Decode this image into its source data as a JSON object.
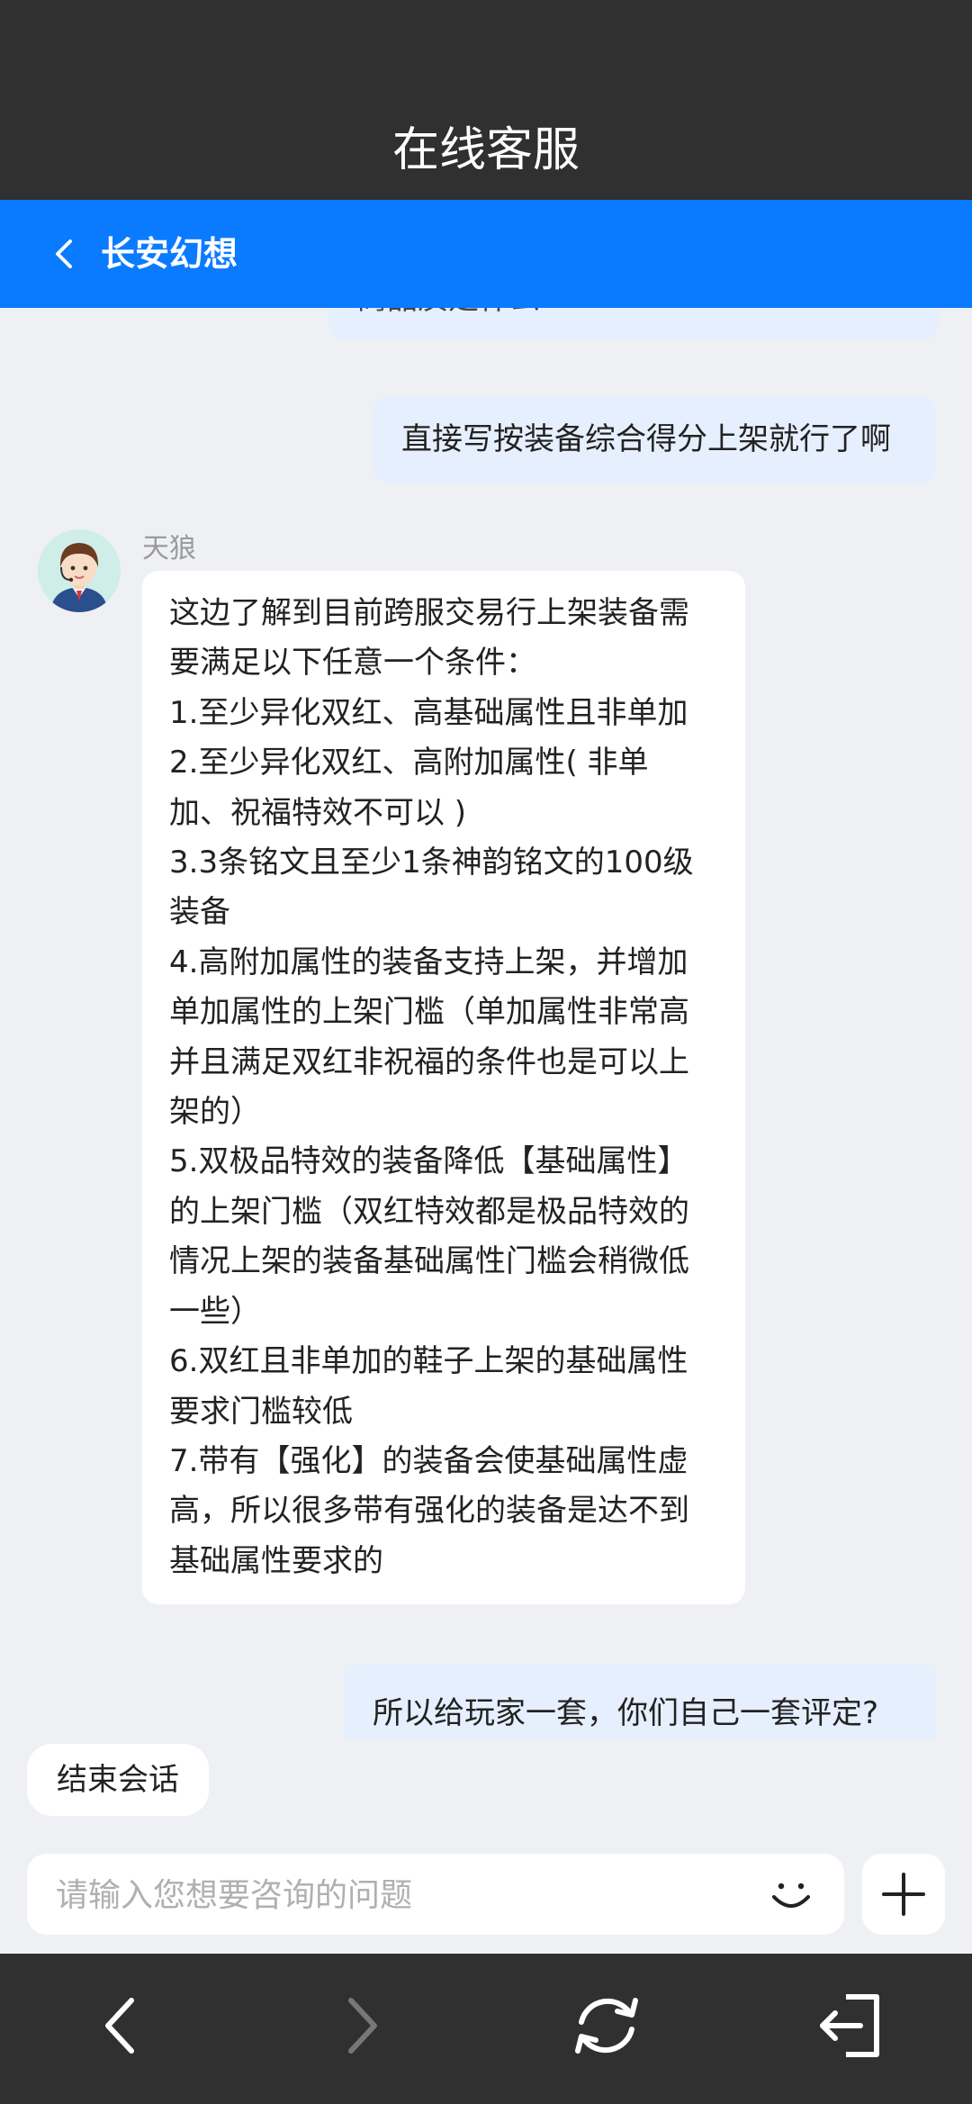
{
  "header": {
    "title": "在线客服"
  },
  "subheader": {
    "game_name": "长安幻想",
    "back_icon": "chevron-left-icon"
  },
  "messages": {
    "partial_user_text": "商品质是什么",
    "user_1": "直接写按装备综合得分上架就行了啊",
    "agent": {
      "name": "天狼",
      "avatar_icon": "customer-service-avatar",
      "lines": [
        "这边了解到目前跨服交易行上架装备需",
        "要满足以下任意一个条件：",
        "1.至少异化双红、高基础属性且非单加",
        "2.至少异化双红、高附加属性( 非单",
        "加、祝福特效不可以 )",
        "3.3条铭文且至少1条神韵铭文的100级",
        "装备",
        "4.高附加属性的装备支持上架，并增加",
        "单加属性的上架门槛（单加属性非常高",
        "并且满足双红非祝福的条件也是可以上",
        "架的）",
        "5.双极品特效的装备降低【基础属性】",
        "的上架门槛（双红特效都是极品特效的",
        "情况上架的装备基础属性门槛会稍微低",
        "一些）",
        "6.双红且非单加的鞋子上架的基础属性",
        "要求门槛较低",
        "7.带有【强化】的装备会使基础属性虚",
        "高，所以很多带有强化的装备是达不到",
        "基础属性要求的"
      ]
    },
    "user_2": "所以给玩家一套，你们自己一套评定?"
  },
  "end_session": {
    "label": "结束会话"
  },
  "input": {
    "placeholder": "请输入您想要咨询的问题",
    "value": "",
    "emoji_icon": "smile-icon",
    "add_icon": "plus-icon"
  },
  "navbar": {
    "icons": [
      "back-arrow-icon",
      "forward-arrow-icon",
      "refresh-icon",
      "exit-icon"
    ]
  },
  "colors": {
    "top_bar": "#303030",
    "accent": "#0a7bff",
    "chat_bg": "#eef0f4",
    "user_bubble": "#e6effd"
  }
}
